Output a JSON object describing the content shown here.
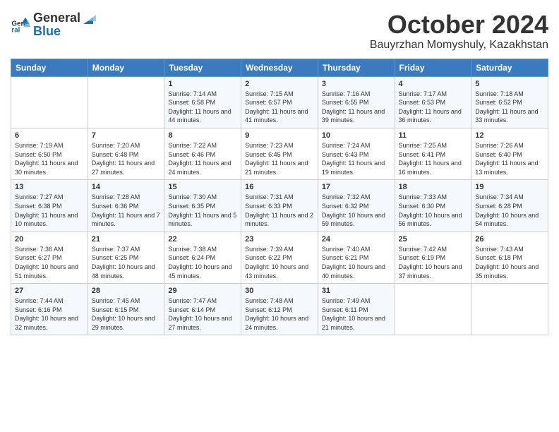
{
  "logo": {
    "general": "General",
    "blue": "Blue"
  },
  "title": {
    "month": "October 2024",
    "location": "Bauyrzhan Momyshuly, Kazakhstan"
  },
  "headers": [
    "Sunday",
    "Monday",
    "Tuesday",
    "Wednesday",
    "Thursday",
    "Friday",
    "Saturday"
  ],
  "weeks": [
    [
      {
        "day": "",
        "sunrise": "",
        "sunset": "",
        "daylight": ""
      },
      {
        "day": "",
        "sunrise": "",
        "sunset": "",
        "daylight": ""
      },
      {
        "day": "1",
        "sunrise": "Sunrise: 7:14 AM",
        "sunset": "Sunset: 6:58 PM",
        "daylight": "Daylight: 11 hours and 44 minutes."
      },
      {
        "day": "2",
        "sunrise": "Sunrise: 7:15 AM",
        "sunset": "Sunset: 6:57 PM",
        "daylight": "Daylight: 11 hours and 41 minutes."
      },
      {
        "day": "3",
        "sunrise": "Sunrise: 7:16 AM",
        "sunset": "Sunset: 6:55 PM",
        "daylight": "Daylight: 11 hours and 39 minutes."
      },
      {
        "day": "4",
        "sunrise": "Sunrise: 7:17 AM",
        "sunset": "Sunset: 6:53 PM",
        "daylight": "Daylight: 11 hours and 36 minutes."
      },
      {
        "day": "5",
        "sunrise": "Sunrise: 7:18 AM",
        "sunset": "Sunset: 6:52 PM",
        "daylight": "Daylight: 11 hours and 33 minutes."
      }
    ],
    [
      {
        "day": "6",
        "sunrise": "Sunrise: 7:19 AM",
        "sunset": "Sunset: 6:50 PM",
        "daylight": "Daylight: 11 hours and 30 minutes."
      },
      {
        "day": "7",
        "sunrise": "Sunrise: 7:20 AM",
        "sunset": "Sunset: 6:48 PM",
        "daylight": "Daylight: 11 hours and 27 minutes."
      },
      {
        "day": "8",
        "sunrise": "Sunrise: 7:22 AM",
        "sunset": "Sunset: 6:46 PM",
        "daylight": "Daylight: 11 hours and 24 minutes."
      },
      {
        "day": "9",
        "sunrise": "Sunrise: 7:23 AM",
        "sunset": "Sunset: 6:45 PM",
        "daylight": "Daylight: 11 hours and 21 minutes."
      },
      {
        "day": "10",
        "sunrise": "Sunrise: 7:24 AM",
        "sunset": "Sunset: 6:43 PM",
        "daylight": "Daylight: 11 hours and 19 minutes."
      },
      {
        "day": "11",
        "sunrise": "Sunrise: 7:25 AM",
        "sunset": "Sunset: 6:41 PM",
        "daylight": "Daylight: 11 hours and 16 minutes."
      },
      {
        "day": "12",
        "sunrise": "Sunrise: 7:26 AM",
        "sunset": "Sunset: 6:40 PM",
        "daylight": "Daylight: 11 hours and 13 minutes."
      }
    ],
    [
      {
        "day": "13",
        "sunrise": "Sunrise: 7:27 AM",
        "sunset": "Sunset: 6:38 PM",
        "daylight": "Daylight: 11 hours and 10 minutes."
      },
      {
        "day": "14",
        "sunrise": "Sunrise: 7:28 AM",
        "sunset": "Sunset: 6:36 PM",
        "daylight": "Daylight: 11 hours and 7 minutes."
      },
      {
        "day": "15",
        "sunrise": "Sunrise: 7:30 AM",
        "sunset": "Sunset: 6:35 PM",
        "daylight": "Daylight: 11 hours and 5 minutes."
      },
      {
        "day": "16",
        "sunrise": "Sunrise: 7:31 AM",
        "sunset": "Sunset: 6:33 PM",
        "daylight": "Daylight: 11 hours and 2 minutes."
      },
      {
        "day": "17",
        "sunrise": "Sunrise: 7:32 AM",
        "sunset": "Sunset: 6:32 PM",
        "daylight": "Daylight: 10 hours and 59 minutes."
      },
      {
        "day": "18",
        "sunrise": "Sunrise: 7:33 AM",
        "sunset": "Sunset: 6:30 PM",
        "daylight": "Daylight: 10 hours and 56 minutes."
      },
      {
        "day": "19",
        "sunrise": "Sunrise: 7:34 AM",
        "sunset": "Sunset: 6:28 PM",
        "daylight": "Daylight: 10 hours and 54 minutes."
      }
    ],
    [
      {
        "day": "20",
        "sunrise": "Sunrise: 7:36 AM",
        "sunset": "Sunset: 6:27 PM",
        "daylight": "Daylight: 10 hours and 51 minutes."
      },
      {
        "day": "21",
        "sunrise": "Sunrise: 7:37 AM",
        "sunset": "Sunset: 6:25 PM",
        "daylight": "Daylight: 10 hours and 48 minutes."
      },
      {
        "day": "22",
        "sunrise": "Sunrise: 7:38 AM",
        "sunset": "Sunset: 6:24 PM",
        "daylight": "Daylight: 10 hours and 45 minutes."
      },
      {
        "day": "23",
        "sunrise": "Sunrise: 7:39 AM",
        "sunset": "Sunset: 6:22 PM",
        "daylight": "Daylight: 10 hours and 43 minutes."
      },
      {
        "day": "24",
        "sunrise": "Sunrise: 7:40 AM",
        "sunset": "Sunset: 6:21 PM",
        "daylight": "Daylight: 10 hours and 40 minutes."
      },
      {
        "day": "25",
        "sunrise": "Sunrise: 7:42 AM",
        "sunset": "Sunset: 6:19 PM",
        "daylight": "Daylight: 10 hours and 37 minutes."
      },
      {
        "day": "26",
        "sunrise": "Sunrise: 7:43 AM",
        "sunset": "Sunset: 6:18 PM",
        "daylight": "Daylight: 10 hours and 35 minutes."
      }
    ],
    [
      {
        "day": "27",
        "sunrise": "Sunrise: 7:44 AM",
        "sunset": "Sunset: 6:16 PM",
        "daylight": "Daylight: 10 hours and 32 minutes."
      },
      {
        "day": "28",
        "sunrise": "Sunrise: 7:45 AM",
        "sunset": "Sunset: 6:15 PM",
        "daylight": "Daylight: 10 hours and 29 minutes."
      },
      {
        "day": "29",
        "sunrise": "Sunrise: 7:47 AM",
        "sunset": "Sunset: 6:14 PM",
        "daylight": "Daylight: 10 hours and 27 minutes."
      },
      {
        "day": "30",
        "sunrise": "Sunrise: 7:48 AM",
        "sunset": "Sunset: 6:12 PM",
        "daylight": "Daylight: 10 hours and 24 minutes."
      },
      {
        "day": "31",
        "sunrise": "Sunrise: 7:49 AM",
        "sunset": "Sunset: 6:11 PM",
        "daylight": "Daylight: 10 hours and 21 minutes."
      },
      {
        "day": "",
        "sunrise": "",
        "sunset": "",
        "daylight": ""
      },
      {
        "day": "",
        "sunrise": "",
        "sunset": "",
        "daylight": ""
      }
    ]
  ]
}
